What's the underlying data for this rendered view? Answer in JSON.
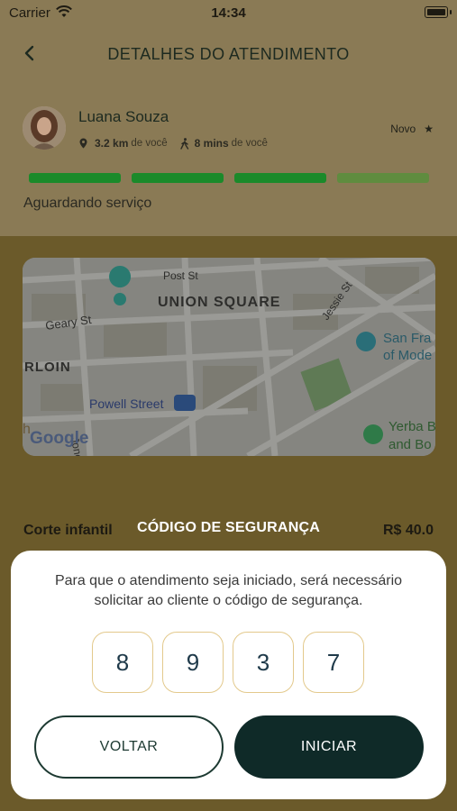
{
  "status_bar": {
    "carrier": "Carrier",
    "time": "14:34"
  },
  "header": {
    "title": "DETALHES DO ATENDIMENTO"
  },
  "client": {
    "name": "Luana Souza",
    "distance_value": "3.2 km",
    "distance_suffix": "de você",
    "time_value": "8 mins",
    "time_suffix": "de você",
    "badge": "Novo"
  },
  "progress": {
    "completed_steps": 3,
    "total_steps": 4,
    "colors": {
      "done": "#1b8a2a",
      "pending": "#5f8c3f"
    }
  },
  "service_status": "Aguardando serviço",
  "map": {
    "labels": {
      "post_st": "Post St",
      "union_square": "UNION SQUARE",
      "geary_st": "Geary St",
      "jessie_st": "Jessie St",
      "rloin": "RLOIN",
      "san_fran": "San Fra",
      "of_mode": "of Mode",
      "powell": "Powell Street",
      "jones_st": "Jones St",
      "yerba_1": "Yerba B",
      "yerba_2": "and Bo",
      "h": "h",
      "google": "Google"
    }
  },
  "service": {
    "name": "Corte infantil",
    "price": "R$ 40.0"
  },
  "modal": {
    "title": "CÓDIGO DE SEGURANÇA",
    "message": "Para que o atendimento seja iniciado, será necessário solicitar ao cliente o código de segurança.",
    "code": [
      "8",
      "9",
      "3",
      "7"
    ],
    "back_label": "VOLTAR",
    "start_label": "INICIAR"
  }
}
